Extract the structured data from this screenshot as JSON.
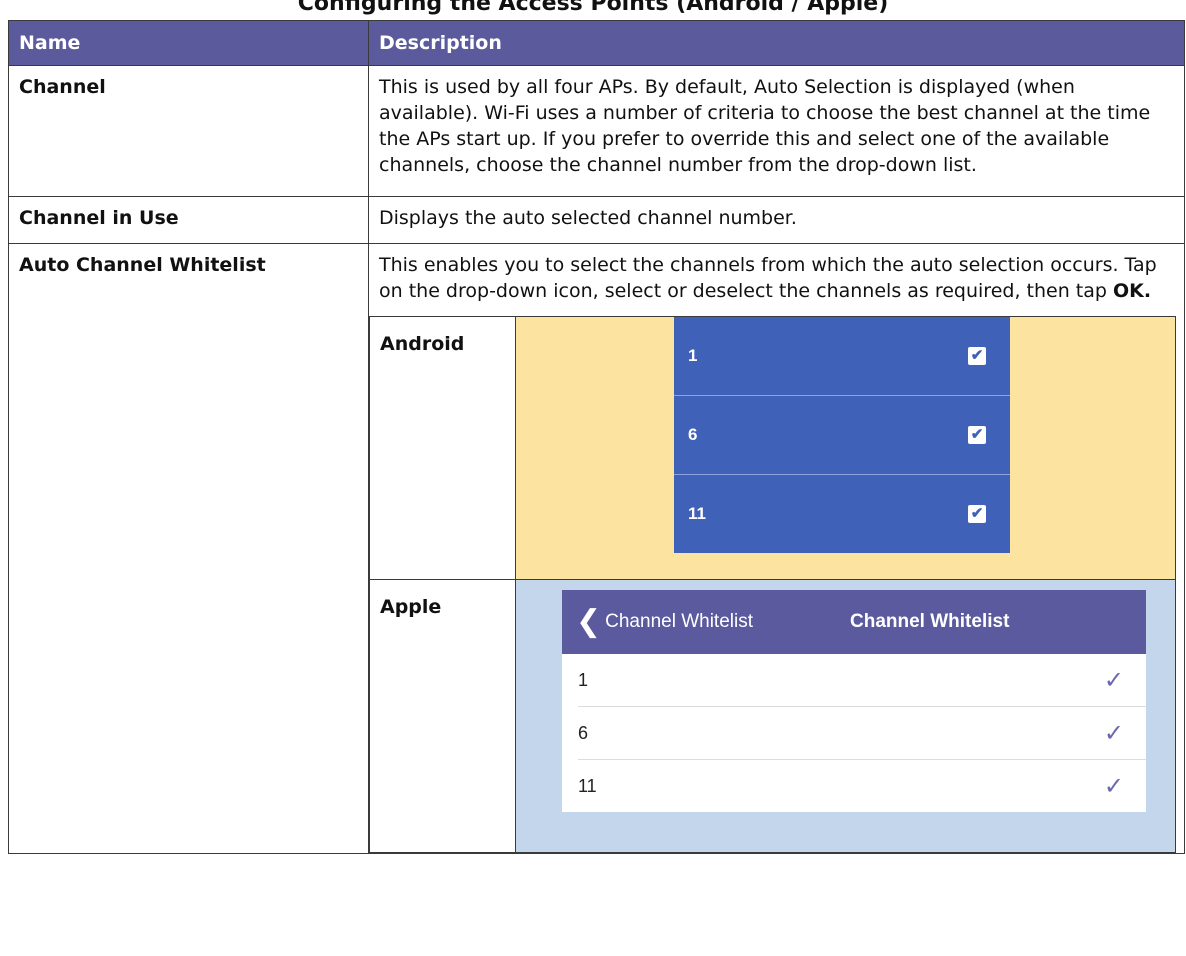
{
  "page": {
    "heading": "Configuring the Access Points (Android / Apple)"
  },
  "table": {
    "headers": {
      "name": "Name",
      "description": "Description"
    },
    "rows": [
      {
        "name": "Channel",
        "description": "This is used by all four APs. By default, Auto Selection is displayed (when available). Wi-Fi uses a number of criteria to choose the best channel at the time the APs start up. If you prefer to override this and select one of the available channels, choose the channel number from the drop-down list."
      },
      {
        "name": "Channel in Use",
        "description": "Displays the auto selected channel number."
      },
      {
        "name": "Auto Channel Whitelist",
        "description_before": "This enables you to select the channels from which the auto selection occurs. Tap on the drop-down icon, select or deselect the channels as required, then tap ",
        "description_bold": "OK."
      }
    ]
  },
  "android": {
    "label": "Android",
    "items": [
      {
        "label": "1",
        "checked": true
      },
      {
        "label": "6",
        "checked": true
      },
      {
        "label": "11",
        "checked": true
      }
    ],
    "check_glyph": "✔",
    "list_color": "#4061b8",
    "bg_color": "#fce39f"
  },
  "apple": {
    "label": "Apple",
    "back_chevron": "❮",
    "back_label": "Channel Whitelist",
    "title": "Channel Whitelist",
    "items": [
      {
        "label": "1",
        "checked": true
      },
      {
        "label": "6",
        "checked": true
      },
      {
        "label": "11",
        "checked": true
      }
    ],
    "check_glyph": "✓",
    "navbar_color": "#5b5a9e",
    "bg_color": "#c3d6ec"
  }
}
